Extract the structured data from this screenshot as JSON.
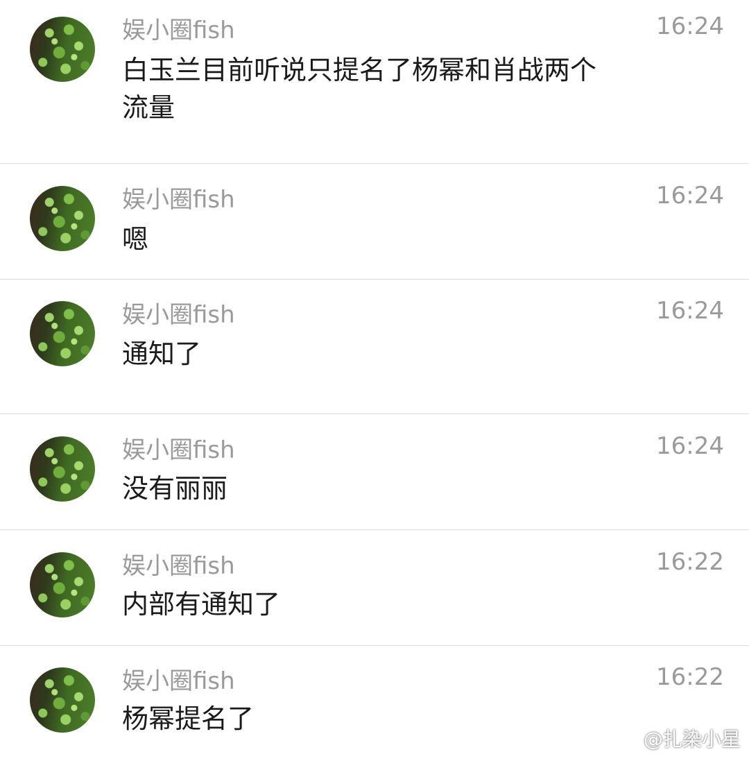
{
  "messages": [
    {
      "sender": "娱小圈fish",
      "text": "白玉兰目前听说只提名了杨幂和肖战两个流量",
      "time": "16:24"
    },
    {
      "sender": "娱小圈fish",
      "text": "嗯",
      "time": "16:24"
    },
    {
      "sender": "娱小圈fish",
      "text": "通知了",
      "time": "16:24"
    },
    {
      "sender": "娱小圈fish",
      "text": "没有丽丽",
      "time": "16:24"
    },
    {
      "sender": "娱小圈fish",
      "text": "内部有通知了",
      "time": "16:22"
    },
    {
      "sender": "娱小圈fish",
      "text": "杨幂提名了",
      "time": "16:22"
    }
  ],
  "watermark": {
    "text": "@扎染小星",
    "icon": "weibo-icon"
  }
}
